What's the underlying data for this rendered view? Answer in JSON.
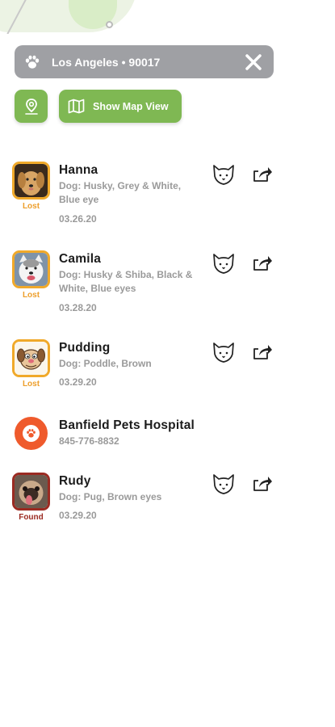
{
  "search": {
    "location": "Los Angeles • 90017"
  },
  "map_button": {
    "label": "Show Map View"
  },
  "colors": {
    "accent_green": "#7fb853",
    "lost_orange": "#ed9e2a",
    "found_red": "#9b2b22",
    "hospital_orange": "#ef5a2c",
    "bar_grey": "#9fa0a4"
  },
  "pets": [
    {
      "name": "Hanna",
      "desc": "Dog: Husky, Grey & White, Blue eye",
      "date": "03.26.20",
      "status": "Lost"
    },
    {
      "name": "Camila",
      "desc": "Dog: Husky & Shiba, Black & White, Blue eyes",
      "date": "03.28.20",
      "status": "Lost"
    },
    {
      "name": "Pudding",
      "desc": "Dog: Poddle, Brown",
      "date": "03.29.20",
      "status": "Lost"
    },
    {
      "name": "Rudy",
      "desc": "Dog: Pug, Brown eyes",
      "date": "03.29.20",
      "status": "Found"
    }
  ],
  "hospital": {
    "name": "Banfield Pets Hospital",
    "phone": "845-776-8832"
  }
}
